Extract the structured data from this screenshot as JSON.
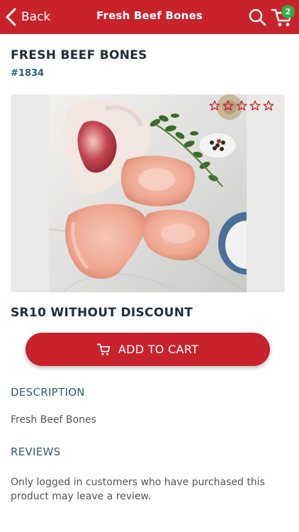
{
  "header": {
    "back_label": "Back",
    "title": "Fresh Beef Bones",
    "cart_count": "2"
  },
  "product": {
    "name": "FRESH BEEF BONES",
    "sku": "#1834",
    "price_line": "SR10 WITHOUT DISCOUNT",
    "rating": 0,
    "rating_max": 5
  },
  "actions": {
    "add_to_cart_label": "ADD TO CART"
  },
  "description": {
    "heading": "DESCRIPTION",
    "text": "Fresh Beef Bones"
  },
  "reviews": {
    "heading": "REVIEWS",
    "text": "Only logged in customers who have purchased this product may leave a review."
  },
  "icons": {
    "back": "chevron-left-icon",
    "search": "search-icon",
    "cart": "cart-icon",
    "star": "star-outline-icon"
  },
  "colors": {
    "brand_red": "#c8232c",
    "badge_green": "#2fae4a",
    "heading_teal": "#2c5f70"
  }
}
